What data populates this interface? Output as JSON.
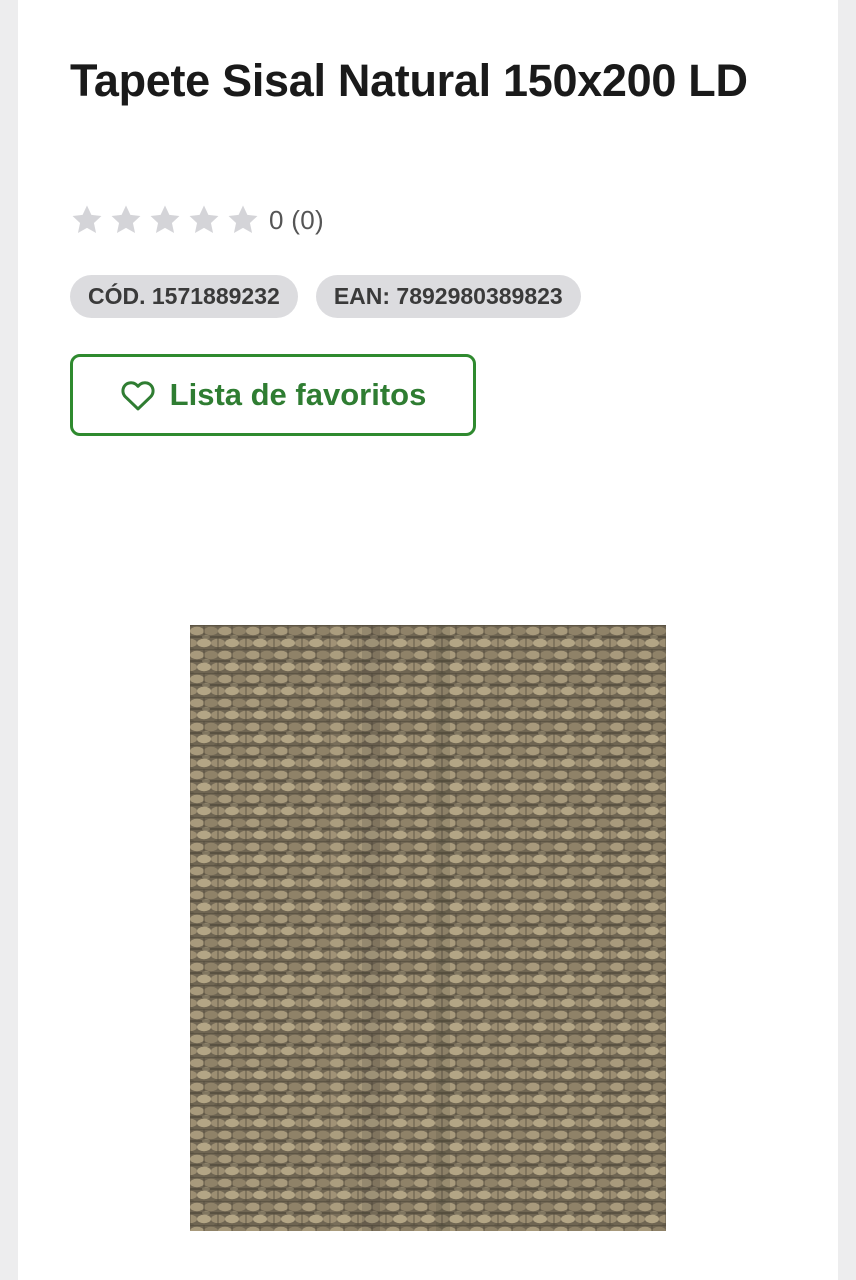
{
  "product": {
    "title": "Tapete Sisal Natural 150x200 LD",
    "rating": {
      "score": 0,
      "max": 5,
      "text": "0 (0)"
    },
    "codes": {
      "cod_label": "CÓD. 1571889232",
      "ean_label": "EAN: 7892980389823"
    },
    "favorites_button": {
      "label": "Lista de favoritos",
      "icon": "heart-outline-icon"
    },
    "image": {
      "description_icon": "sisal-rug-photo"
    }
  },
  "colors": {
    "accent_green": "#2f8a2f",
    "badge_bg": "#dcdcdf",
    "star_empty": "#d4d4d8",
    "page_bg": "#ededee"
  }
}
